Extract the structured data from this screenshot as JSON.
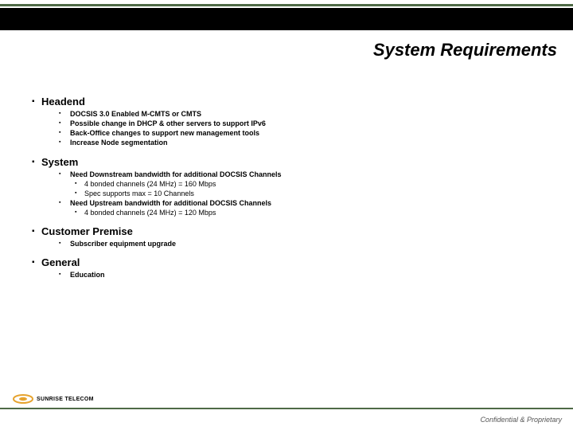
{
  "title": "System Requirements",
  "sections": {
    "headend": {
      "heading": "Headend",
      "items": [
        "DOCSIS 3.0 Enabled M-CMTS or CMTS",
        "Possible change in DHCP & other servers to support IPv6",
        "Back-Office changes to support new management tools",
        "Increase Node segmentation"
      ]
    },
    "system": {
      "heading": "System",
      "items": [
        {
          "text": "Need Downstream bandwidth for additional DOCSIS Channels",
          "sub": [
            "4 bonded channels (24 MHz) = 160 Mbps",
            "Spec supports max = 10 Channels"
          ]
        },
        {
          "text": "Need Upstream bandwidth for additional DOCSIS Channels",
          "sub": [
            "4 bonded channels (24 MHz) = 120 Mbps"
          ]
        }
      ]
    },
    "customer": {
      "heading": "Customer Premise",
      "items": [
        "Subscriber equipment upgrade"
      ]
    },
    "general": {
      "heading": "General",
      "items": [
        "Education"
      ]
    }
  },
  "logo_text": "SUNRISE TELECOM",
  "footer": "Confidential & Proprietary"
}
